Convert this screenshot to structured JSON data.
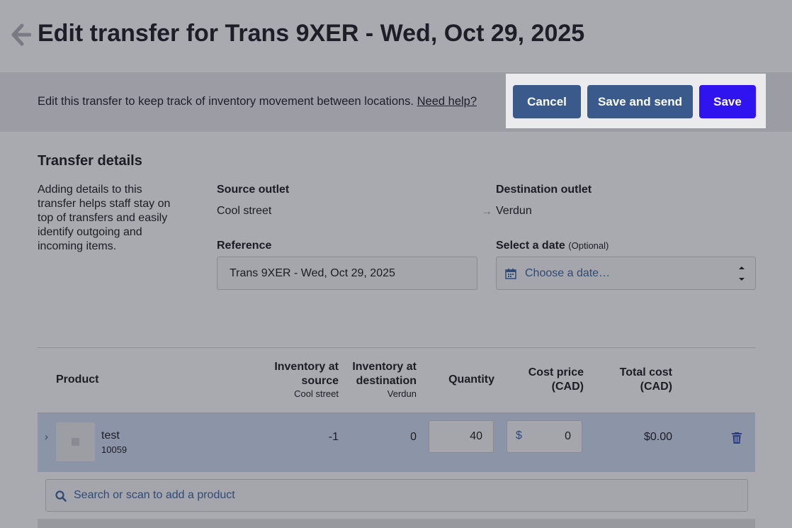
{
  "header": {
    "title": "Edit transfer for Trans 9XER - Wed, Oct 29, 2025"
  },
  "intro": {
    "text": "Edit this transfer to keep track of inventory movement between locations.",
    "help_link": "Need help?"
  },
  "actions": {
    "cancel": "Cancel",
    "save_and_send": "Save and send",
    "save": "Save",
    "colors": {
      "secondary": "#3a5a8c",
      "primary": "#3014f0"
    }
  },
  "details": {
    "title": "Transfer details",
    "description": "Adding details to this transfer helps staff stay on top of transfers and easily identify outgoing and incoming items.",
    "source_label": "Source outlet",
    "source_value": "Cool street",
    "destination_label": "Destination outlet",
    "destination_value": "Verdun",
    "reference_label": "Reference",
    "reference_value": "Trans 9XER - Wed, Oct 29, 2025",
    "date_label": "Select a date",
    "date_optional": "(Optional)",
    "date_placeholder": "Choose a date…"
  },
  "table": {
    "headers": {
      "product": "Product",
      "inv_source": "Inventory at source",
      "inv_source_sub": "Cool street",
      "inv_dest": "Inventory at destination",
      "inv_dest_sub": "Verdun",
      "quantity": "Quantity",
      "cost_price": "Cost price (CAD)",
      "total_cost": "Total cost (CAD)"
    },
    "rows": [
      {
        "name": "test",
        "sku": "10059",
        "inv_source": "-1",
        "inv_dest": "0",
        "quantity": "40",
        "currency_symbol": "$",
        "cost_price": "0",
        "total_cost": "$0.00"
      }
    ]
  },
  "search": {
    "placeholder": "Search or scan to add a product"
  }
}
